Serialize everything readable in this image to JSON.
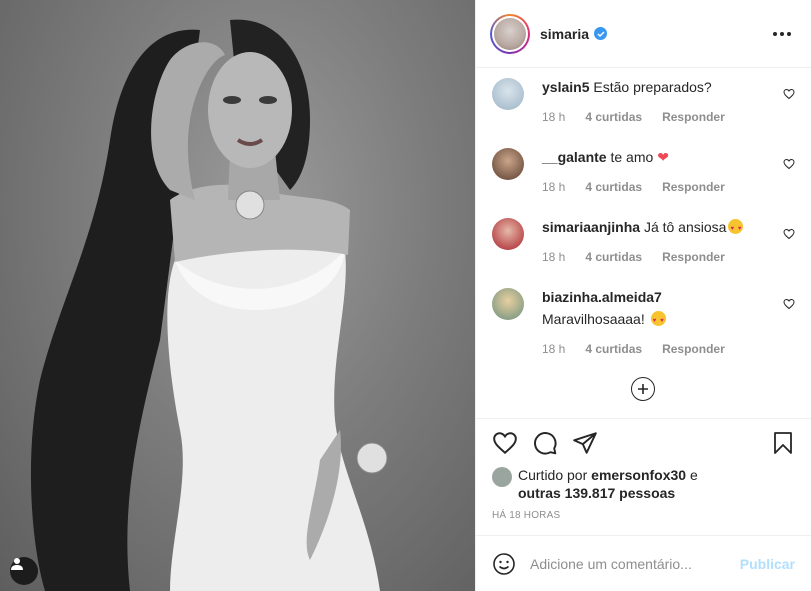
{
  "post": {
    "username": "simaria",
    "verified": true,
    "photo_alt": "simaria"
  },
  "comments": [
    {
      "user": "yslain5",
      "text": "Estão preparados?",
      "time": "18 h",
      "likes": "4 curtidas",
      "reply": "Responder",
      "emoji": ""
    },
    {
      "user": "__galante",
      "text": "te amo",
      "time": "18 h",
      "likes": "4 curtidas",
      "reply": "Responder",
      "emoji": "heart"
    },
    {
      "user": "simariaanjinha",
      "text": "Já tô ansiosa",
      "time": "18 h",
      "likes": "4 curtidas",
      "reply": "Responder",
      "emoji": "heart-eyes"
    },
    {
      "user": "biazinha.almeida7",
      "text": "Maravilhosaaaa!",
      "time": "18 h",
      "likes": "4 curtidas",
      "reply": "Responder",
      "emoji": "heart-eyes"
    }
  ],
  "likes": {
    "prefix": "Curtido por",
    "user": "emersonfox30",
    "and": "e",
    "others": "outras 139.817 pessoas"
  },
  "timestamp": "HÁ 18 HORAS",
  "add_comment": {
    "placeholder": "Adicione um comentário...",
    "publish": "Publicar"
  },
  "icons": [
    "heart-icon",
    "comment-icon",
    "share-icon",
    "bookmark-icon",
    "emoji-icon",
    "add-circle-icon",
    "more-icon",
    "user-tag-icon"
  ],
  "colors": {
    "verified": "#3897f0",
    "heart": "#ed4956",
    "publish_disabled": "#b2dffc"
  }
}
